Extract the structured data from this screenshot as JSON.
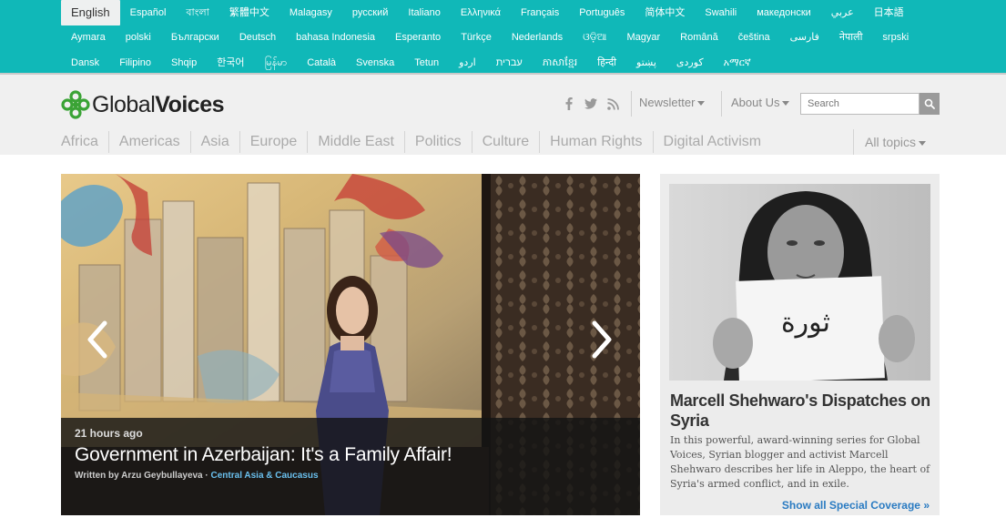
{
  "languages": {
    "row1": [
      "English",
      "Español",
      "বাংলা",
      "繁體中文",
      "Malagasy",
      "русский",
      "Italiano",
      "Ελληνικά",
      "Français",
      "Português",
      "简体中文",
      "Swahili",
      "македонски",
      "عربي",
      "日本語"
    ],
    "row2": [
      "Aymara",
      "polski",
      "Български",
      "Deutsch",
      "bahasa Indonesia",
      "Esperanto",
      "Türkçe",
      "Nederlands",
      "ଓଡ଼ିଆ",
      "Magyar",
      "Română",
      "čeština",
      "فارسی",
      "नेपाली",
      "srpski"
    ],
    "row3": [
      "Dansk",
      "Filipino",
      "Shqip",
      "한국어",
      "မြန်မာ",
      "Català",
      "Svenska",
      "Tetun",
      "اردو",
      "עברית",
      "ភាសាខ្មែរ",
      "हिन्दी",
      "پښتو",
      "کوردی",
      "አማርኛ"
    ],
    "active": "English"
  },
  "header": {
    "logo_light": "Global",
    "logo_bold": "Voices",
    "newsletter": "Newsletter",
    "about": "About Us",
    "search_placeholder": "Search",
    "social_icons": [
      "facebook-icon",
      "twitter-icon",
      "rss-icon"
    ]
  },
  "topics": [
    "Africa",
    "Americas",
    "Asia",
    "Europe",
    "Middle East",
    "Politics",
    "Culture",
    "Human Rights",
    "Digital Activism"
  ],
  "all_topics": "All topics",
  "hero": {
    "time": "21 hours ago",
    "title": "Government in Azerbaijan: It's a Family Affair!",
    "written_by": "Written by",
    "author": "Arzu Geybullayeva",
    "separator": " · ",
    "category": "Central Asia & Caucasus"
  },
  "feature": {
    "title": "Marcell Shehwaro's Dispatches on Syria",
    "description": "In this powerful, award-winning series for Global Voices, Syrian blogger and activist Marcell Shehwaro describes her life in Aleppo, the heart of Syria's armed conflict, and in exile.",
    "more": "Show all Special Coverage »",
    "sign_text": "ثورة"
  },
  "colors": {
    "brand_teal": "#10b8b8",
    "logo_green": "#3aa335",
    "link_blue": "#2a7bc2"
  }
}
